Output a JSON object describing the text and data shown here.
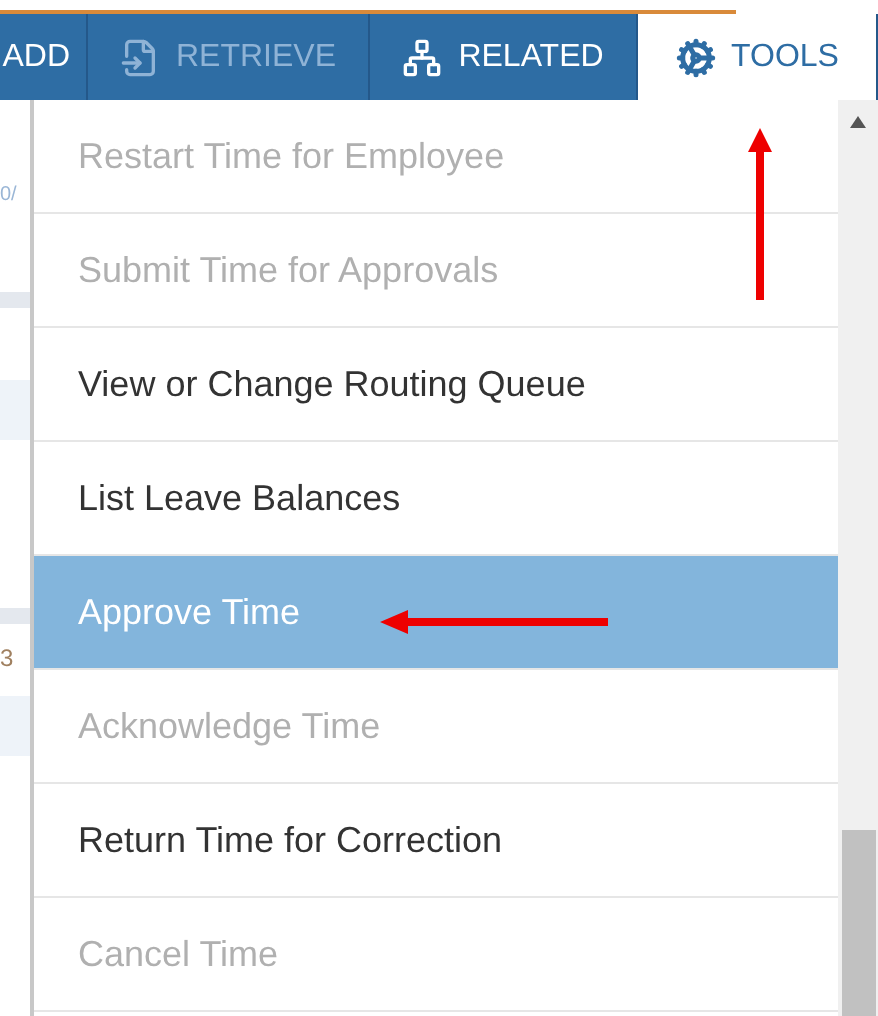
{
  "tabs": [
    {
      "label": "ADD",
      "kind": "text",
      "disabled": false,
      "selected": false
    },
    {
      "label": "RETRIEVE",
      "kind": "document",
      "disabled": true,
      "selected": false
    },
    {
      "label": "RELATED",
      "kind": "hierarchy",
      "disabled": false,
      "selected": false
    },
    {
      "label": "TOOLS",
      "kind": "gear",
      "disabled": false,
      "selected": true
    }
  ],
  "background_fragments": [
    "0/",
    "3"
  ],
  "menu": {
    "items": [
      {
        "label": "Restart Time for Employee",
        "disabled": true,
        "selected": false
      },
      {
        "label": "Submit Time for Approvals",
        "disabled": true,
        "selected": false
      },
      {
        "label": "View or Change Routing Queue",
        "disabled": false,
        "selected": false
      },
      {
        "label": "List Leave Balances",
        "disabled": false,
        "selected": false
      },
      {
        "label": "Approve Time",
        "disabled": false,
        "selected": true
      },
      {
        "label": "Acknowledge Time",
        "disabled": true,
        "selected": false
      },
      {
        "label": "Return Time for Correction",
        "disabled": false,
        "selected": false
      },
      {
        "label": "Cancel Time",
        "disabled": true,
        "selected": false
      }
    ]
  }
}
